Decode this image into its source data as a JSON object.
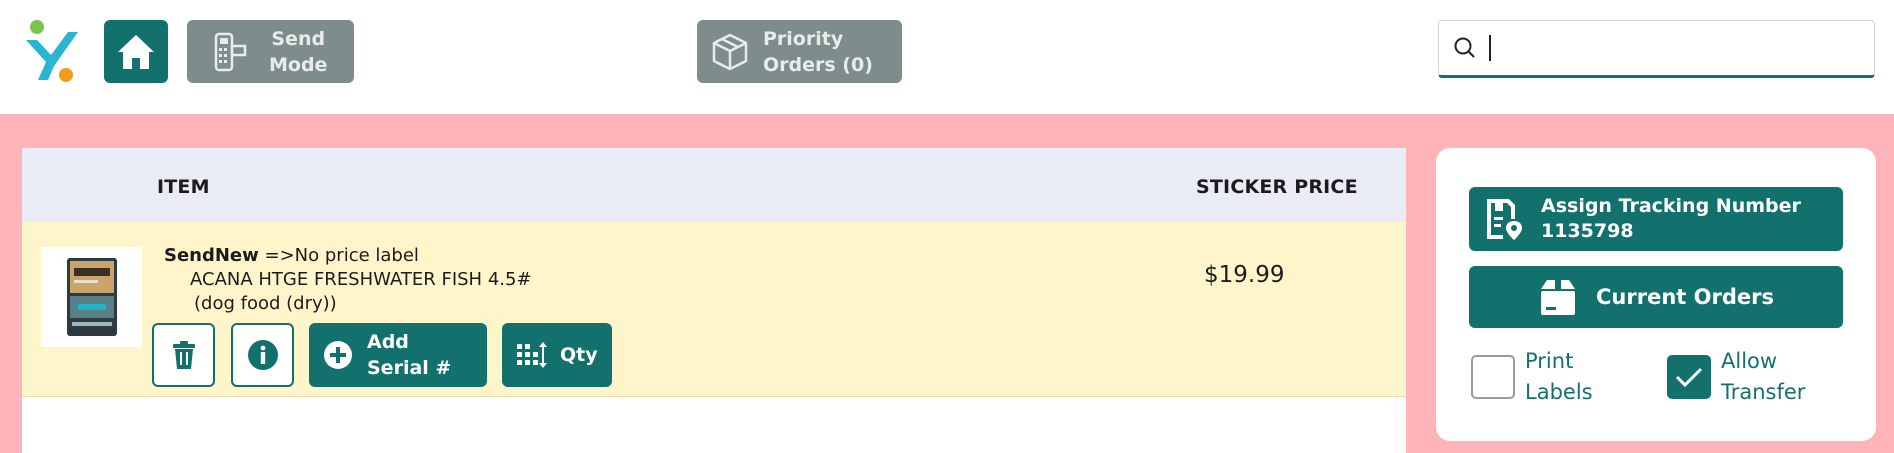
{
  "topbar": {
    "send_mode_line1": "Send",
    "send_mode_line2": "Mode",
    "priority_line1": "Priority",
    "priority_line2": "Orders (0)",
    "search_value": ""
  },
  "table": {
    "headers": {
      "item": "ITEM",
      "sticker_price": "STICKER PRICE"
    },
    "rows": [
      {
        "brand": "SendNew",
        "note": " =>No price label",
        "name": "ACANA HTGE FRESHWATER FISH 4.5#",
        "category": "(dog food (dry))",
        "price": "$19.99",
        "actions": {
          "serial_line1": "Add",
          "serial_line2": "Serial #",
          "qty": "Qty"
        }
      }
    ]
  },
  "panel": {
    "track_line1": "Assign Tracking Number",
    "track_line2": "1135798",
    "current_orders": "Current Orders",
    "print_labels_line1": "Print",
    "print_labels_line2": "Labels",
    "print_labels_checked": false,
    "allow_transfer_line1": "Allow",
    "allow_transfer_line2": "Transfer",
    "allow_transfer_checked": true
  },
  "colors": {
    "primary": "#13716d",
    "disabled": "#7e8d8b",
    "background": "#ffb4b9",
    "table_header": "#e9ecf5",
    "row_highlight": "#fff5cb"
  },
  "icons": [
    "app-logo",
    "home-icon",
    "card-reader-icon",
    "box-icon",
    "search-icon",
    "trash-icon",
    "info-icon",
    "plus-circle-icon",
    "qty-sort-icon",
    "tracking-icon",
    "orders-box-icon",
    "check-icon"
  ]
}
